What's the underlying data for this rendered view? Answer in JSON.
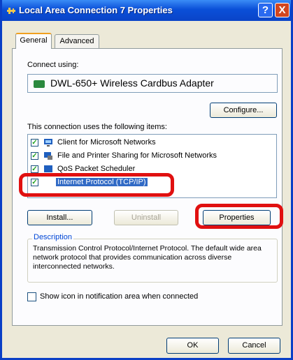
{
  "window": {
    "title": "Local Area Connection 7 Properties",
    "help_label": "?",
    "close_label": "X"
  },
  "tabs": [
    {
      "label": "General",
      "selected": true
    },
    {
      "label": "Advanced",
      "selected": false
    }
  ],
  "connect_using_label": "Connect using:",
  "adapter_name": "DWL-650+ Wireless Cardbus Adapter",
  "configure_label": "Configure...",
  "items_label": "This connection uses the following items:",
  "items": [
    {
      "label": "Client for Microsoft Networks",
      "checked": true,
      "icon": "network-client-icon"
    },
    {
      "label": "File and Printer Sharing for Microsoft Networks",
      "checked": true,
      "icon": "printer-sharing-icon"
    },
    {
      "label": "QoS Packet Scheduler",
      "checked": true,
      "icon": "packet-scheduler-icon"
    },
    {
      "label": "Internet Protocol (TCP/IP)",
      "checked": true,
      "icon": "protocol-icon",
      "selected": true
    }
  ],
  "buttons": {
    "install": "Install...",
    "uninstall": "Uninstall",
    "properties": "Properties",
    "ok": "OK",
    "cancel": "Cancel"
  },
  "description": {
    "title": "Description",
    "text": "Transmission Control Protocol/Internet Protocol. The default wide area network protocol that provides communication across diverse interconnected networks."
  },
  "show_icon_label": "Show icon in notification area when connected",
  "colors": {
    "title_bar": "#0a4fd8",
    "highlight_annotation": "#e01010",
    "selection": "#316ac5"
  }
}
